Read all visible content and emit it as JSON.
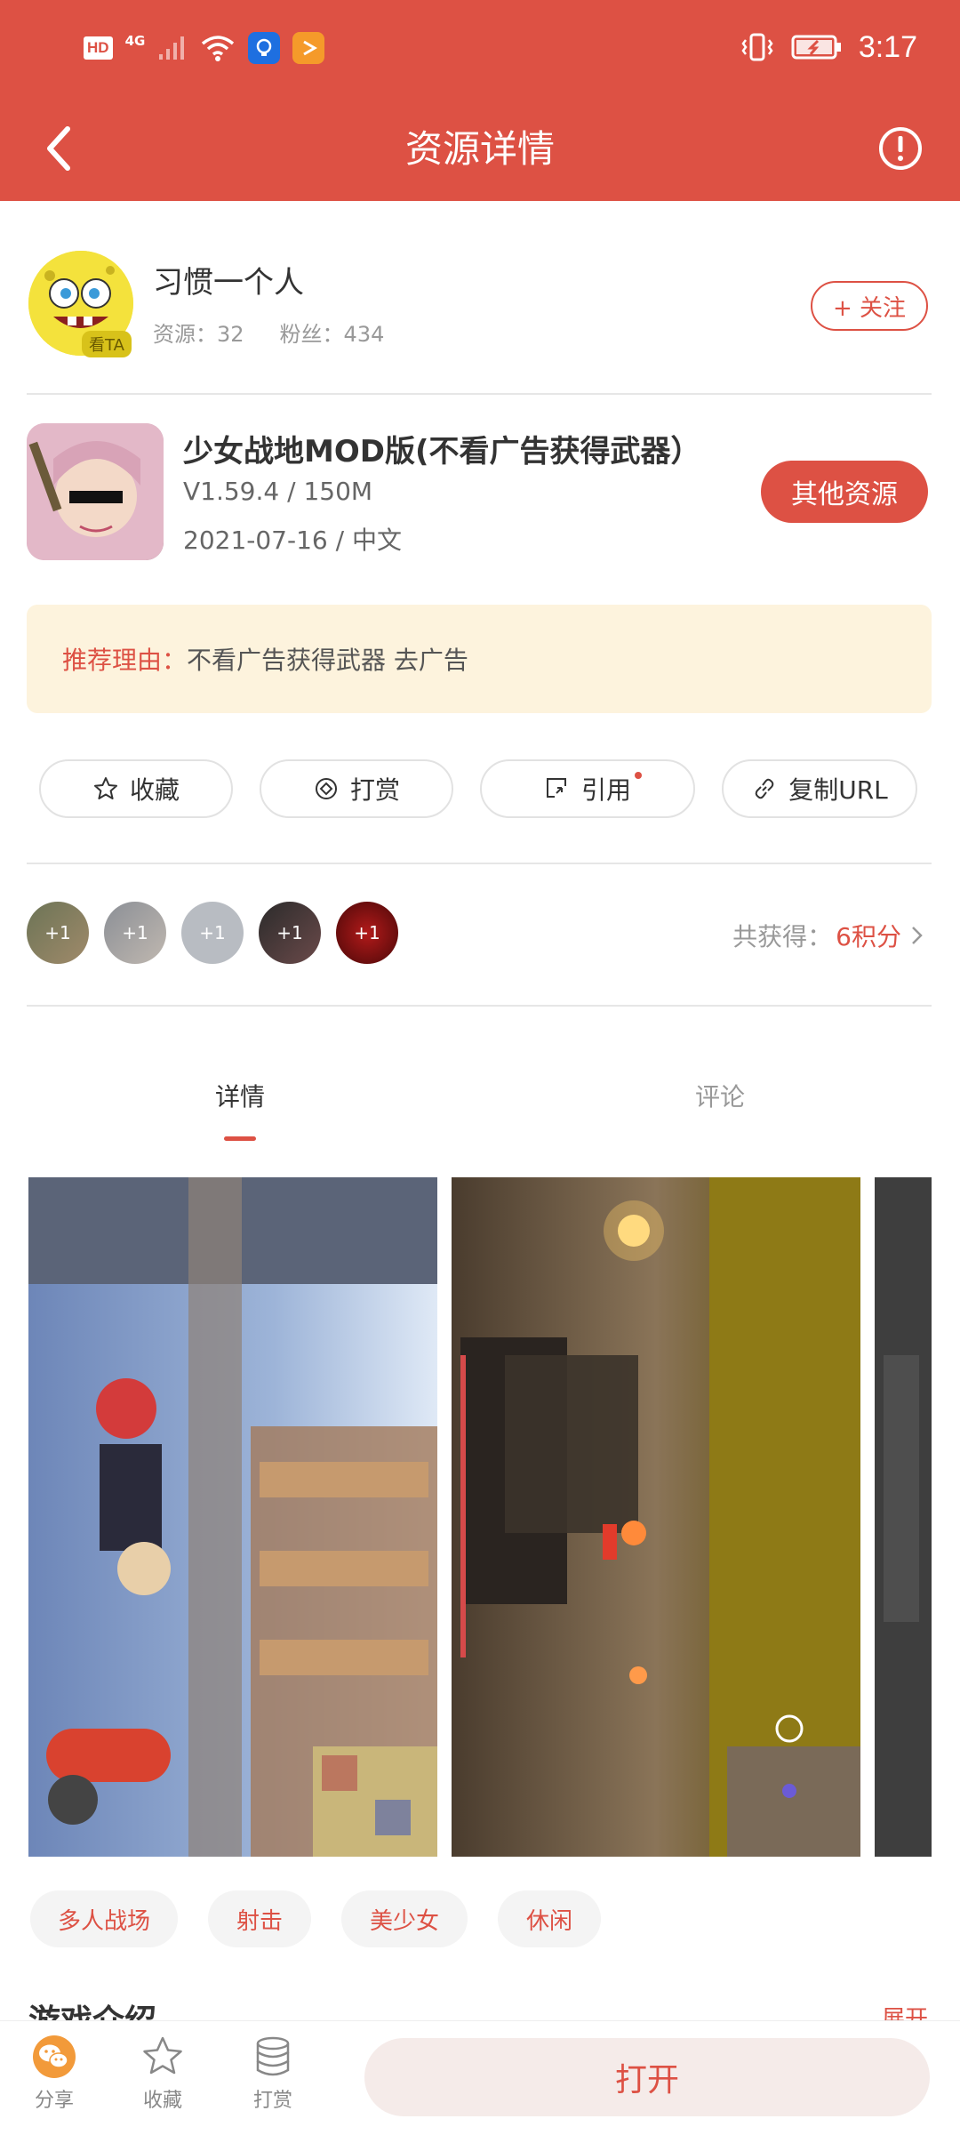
{
  "status_bar": {
    "hd": "HD",
    "network": "4G",
    "time": "3:17"
  },
  "header": {
    "title": "资源详情",
    "back_icon": "chevron-left-icon",
    "report_icon": "exclamation-circle-icon"
  },
  "author": {
    "name": "习惯一个人",
    "avatar_tag": "看TA",
    "resources_label": "资源：32",
    "fans_label": "粉丝：434",
    "follow_label": "+ 关注"
  },
  "app": {
    "name": "少女战地MOD版(不看广告获得武器）",
    "version_size": "V1.59.4 / 150M",
    "date_lang": "2021-07-16 / 中文",
    "other_button": "其他资源"
  },
  "recommend": {
    "label": "推荐理由：",
    "text": "不看广告获得武器 去广告"
  },
  "actions": [
    {
      "label": "收藏",
      "icon": "star-icon"
    },
    {
      "label": "打赏",
      "icon": "reward-icon"
    },
    {
      "label": "引用",
      "icon": "quote-icon"
    },
    {
      "label": "复制URL",
      "icon": "link-icon"
    }
  ],
  "supporters": {
    "badges": [
      "+1",
      "+1",
      "+1",
      "+1",
      "+1"
    ],
    "earned_label": "共获得：",
    "earned_value": "6积分"
  },
  "tabs": [
    {
      "label": "详情",
      "active": true
    },
    {
      "label": "评论",
      "active": false
    }
  ],
  "tags": [
    "多人战场",
    "射击",
    "美少女",
    "休闲"
  ],
  "intro": {
    "title": "游戏介绍",
    "expand": "展开"
  },
  "bottom_bar": {
    "share": "分享",
    "favorite": "收藏",
    "reward": "打赏",
    "open": "打开"
  },
  "colors": {
    "accent": "#dd5144",
    "recommend_bg": "#fdf3dd"
  }
}
